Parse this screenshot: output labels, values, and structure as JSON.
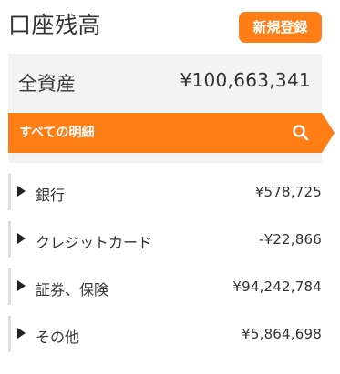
{
  "header": {
    "title": "口座残高",
    "new_button_label": "新規登録"
  },
  "summary": {
    "label": "全資産",
    "value": "¥100,663,341"
  },
  "all_details": {
    "label": "すべての明細",
    "icon": "search-icon",
    "color": "#ff7e15"
  },
  "accounts": [
    {
      "label": "銀行",
      "amount": "¥578,725"
    },
    {
      "label": "クレジットカード",
      "amount": "-¥22,866"
    },
    {
      "label": "証券、保険",
      "amount": "¥94,242,784"
    },
    {
      "label": "その他",
      "amount": "¥5,864,698"
    }
  ]
}
